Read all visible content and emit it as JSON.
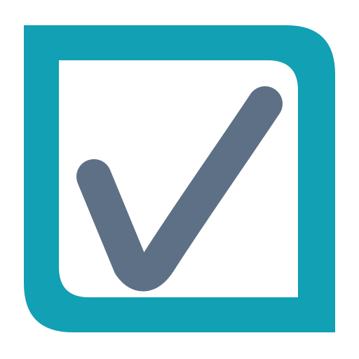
{
  "icon": {
    "name": "checkbox-checked-icon",
    "colors": {
      "frame": "#11a0b4",
      "inner": "#ffffff",
      "check": "#5e7085",
      "background": "#ffffff"
    }
  }
}
